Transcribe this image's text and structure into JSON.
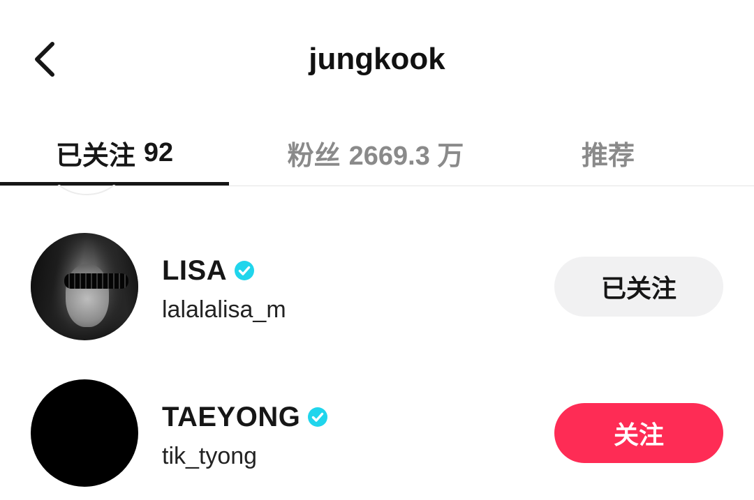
{
  "header": {
    "title": "jungkook",
    "back_icon": "chevron-left-icon"
  },
  "tabs": [
    {
      "label": "已关注",
      "count": "92",
      "active": true
    },
    {
      "label": "粉丝",
      "count": "2669.3 万",
      "active": false
    },
    {
      "label": "推荐",
      "count": "",
      "active": false
    }
  ],
  "users": [
    {
      "display_name": "LISA",
      "username": "lalalalisa_m",
      "verified": true,
      "button_label": "已关注"
    },
    {
      "display_name": "TAEYONG",
      "username": "tik_tyong",
      "verified": true,
      "button_label": "关注"
    }
  ],
  "colors": {
    "accent": "#fe2c55",
    "verified": "#20d5ec",
    "following_bg": "#f1f1f2",
    "inactive_tab": "#8a8a8a"
  }
}
